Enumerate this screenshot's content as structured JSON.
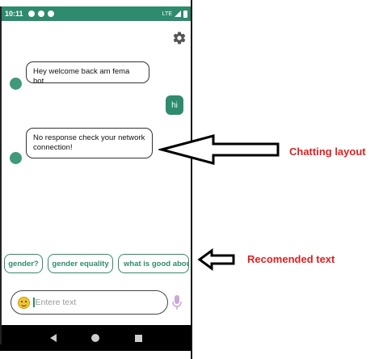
{
  "status_bar": {
    "time": "10:11",
    "network": "LTE"
  },
  "chat": {
    "messages": [
      {
        "from": "bot",
        "text": "Hey welcome back am fema bot"
      },
      {
        "from": "user",
        "text": "hi"
      },
      {
        "from": "bot",
        "text": "No response check your network connection!"
      }
    ]
  },
  "suggestions": [
    "gender?",
    "gender equality",
    "what is good abou"
  ],
  "input": {
    "placeholder": "Entere text"
  },
  "annotations": {
    "chatting_layout": "Chatting layout",
    "recommended_text": "Recomended text"
  },
  "colors": {
    "accent": "#2e8b6e",
    "annotation": "#e02020"
  }
}
